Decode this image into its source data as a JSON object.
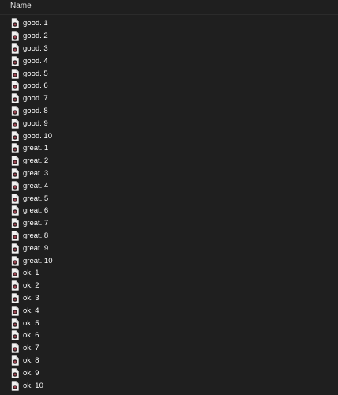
{
  "header": {
    "name_label": "Name",
    "collapse_icon": "chevron-up-icon"
  },
  "files": [
    {
      "label": "good. 1",
      "icon": "music-file-icon"
    },
    {
      "label": "good. 2",
      "icon": "music-file-icon"
    },
    {
      "label": "good. 3",
      "icon": "music-file-icon"
    },
    {
      "label": "good. 4",
      "icon": "music-file-icon"
    },
    {
      "label": "good. 5",
      "icon": "music-file-icon"
    },
    {
      "label": "good. 6",
      "icon": "music-file-icon"
    },
    {
      "label": "good. 7",
      "icon": "music-file-icon"
    },
    {
      "label": "good. 8",
      "icon": "music-file-icon"
    },
    {
      "label": "good. 9",
      "icon": "music-file-icon"
    },
    {
      "label": "good. 10",
      "icon": "music-file-icon"
    },
    {
      "label": "great. 1",
      "icon": "music-file-icon"
    },
    {
      "label": "great. 2",
      "icon": "music-file-icon"
    },
    {
      "label": "great. 3",
      "icon": "music-file-icon"
    },
    {
      "label": "great. 4",
      "icon": "music-file-icon"
    },
    {
      "label": "great. 5",
      "icon": "music-file-icon"
    },
    {
      "label": "great. 6",
      "icon": "music-file-icon"
    },
    {
      "label": "great. 7",
      "icon": "music-file-icon"
    },
    {
      "label": "great. 8",
      "icon": "music-file-icon"
    },
    {
      "label": "great. 9",
      "icon": "music-file-icon"
    },
    {
      "label": "great. 10",
      "icon": "music-file-icon"
    },
    {
      "label": "ok. 1",
      "icon": "music-file-icon"
    },
    {
      "label": "ok. 2",
      "icon": "music-file-icon"
    },
    {
      "label": "ok. 3",
      "icon": "music-file-icon"
    },
    {
      "label": "ok. 4",
      "icon": "music-file-icon"
    },
    {
      "label": "ok. 5",
      "icon": "music-file-icon"
    },
    {
      "label": "ok. 6",
      "icon": "music-file-icon"
    },
    {
      "label": "ok. 7",
      "icon": "music-file-icon"
    },
    {
      "label": "ok. 8",
      "icon": "music-file-icon"
    },
    {
      "label": "ok. 9",
      "icon": "music-file-icon"
    },
    {
      "label": "ok. 10",
      "icon": "music-file-icon"
    }
  ],
  "colors": {
    "background": "#1f1f1f",
    "text": "#ffffff",
    "icon_accent": "#8b1e2d"
  }
}
